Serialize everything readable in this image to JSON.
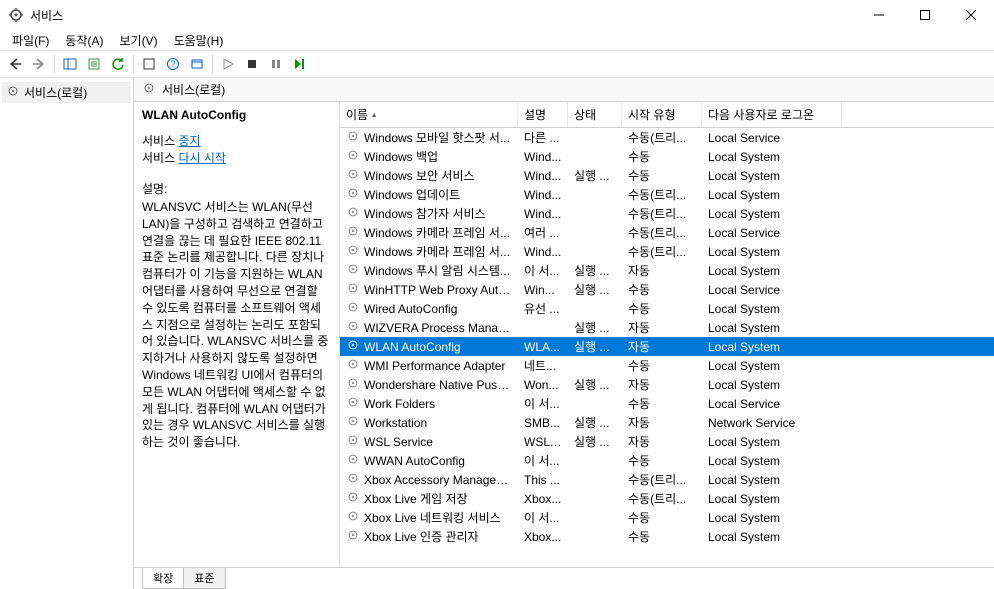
{
  "window": {
    "title": "서비스"
  },
  "menu": {
    "file": "파일(F)",
    "action": "동작(A)",
    "view": "보기(V)",
    "help": "도움말(H)"
  },
  "tree": {
    "root": "서비스(로컬)"
  },
  "right_header": "서비스(로컬)",
  "detail": {
    "title": "WLAN AutoConfig",
    "service_label": "서비스",
    "stop": "중지",
    "restart": "다시 시작",
    "desc_label": "설명:",
    "desc": "WLANSVC 서비스는 WLAN(무선 LAN)을 구성하고 검색하고 연결하고 연결을 끊는 데 필요한 IEEE 802.11 표준 논리를 제공합니다. 다른 장치나 컴퓨터가 이 기능을 지원하는 WLAN 어댑터를 사용하여 무선으로 연결할 수 있도록 컴퓨터를 소프트웨어 액세스 지점으로 설정하는 논리도 포함되어 있습니다. WLANSVC 서비스를 중지하거나 사용하지 않도록 설정하면 Windows 네트워킹 UI에서 컴퓨터의 모든 WLAN 어댑터에 액세스할 수 없게 됩니다. 컴퓨터에 WLAN 어댑터가 있는 경우 WLANSVC 서비스를 실행하는 것이 좋습니다."
  },
  "columns": {
    "name": "이름",
    "desc": "설명",
    "status": "상태",
    "startup": "시작 유형",
    "logon": "다음 사용자로 로그온"
  },
  "services": [
    {
      "name": "Windows 모바일 핫스팟 서...",
      "desc": "다른 ...",
      "status": "",
      "startup": "수동(트리...",
      "logon": "Local Service"
    },
    {
      "name": "Windows 백업",
      "desc": "Wind...",
      "status": "",
      "startup": "수동",
      "logon": "Local System"
    },
    {
      "name": "Windows 보안 서비스",
      "desc": "Wind...",
      "status": "실행 ...",
      "startup": "수동",
      "logon": "Local System"
    },
    {
      "name": "Windows 업데이트",
      "desc": "Wind...",
      "status": "",
      "startup": "수동(트리...",
      "logon": "Local System"
    },
    {
      "name": "Windows 참가자 서비스",
      "desc": "Wind...",
      "status": "",
      "startup": "수동(트리...",
      "logon": "Local System"
    },
    {
      "name": "Windows 카메라 프레임 서...",
      "desc": "여러 ...",
      "status": "",
      "startup": "수동(트리...",
      "logon": "Local Service"
    },
    {
      "name": "Windows 카메라 프레임 서...",
      "desc": "Wind...",
      "status": "",
      "startup": "수동(트리...",
      "logon": "Local System"
    },
    {
      "name": "Windows 푸시 알림 시스템...",
      "desc": "이 서...",
      "status": "실행 ...",
      "startup": "자동",
      "logon": "Local System"
    },
    {
      "name": "WinHTTP Web Proxy Auto-...",
      "desc": "Win...",
      "status": "실행 ...",
      "startup": "수동",
      "logon": "Local Service"
    },
    {
      "name": "Wired AutoConfig",
      "desc": "유선 ...",
      "status": "",
      "startup": "수동",
      "logon": "Local System"
    },
    {
      "name": "WIZVERA Process Manager...",
      "desc": "",
      "status": "실행 ...",
      "startup": "자동",
      "logon": "Local System"
    },
    {
      "name": "WLAN AutoConfig",
      "desc": "WLA...",
      "status": "실행 ...",
      "startup": "자동",
      "logon": "Local System",
      "selected": true
    },
    {
      "name": "WMI Performance Adapter",
      "desc": "네트...",
      "status": "",
      "startup": "수동",
      "logon": "Local System"
    },
    {
      "name": "Wondershare Native Push ...",
      "desc": "Won...",
      "status": "실행 ...",
      "startup": "자동",
      "logon": "Local System"
    },
    {
      "name": "Work Folders",
      "desc": "이 서...",
      "status": "",
      "startup": "수동",
      "logon": "Local Service"
    },
    {
      "name": "Workstation",
      "desc": "SMB...",
      "status": "실행 ...",
      "startup": "자동",
      "logon": "Network Service"
    },
    {
      "name": "WSL Service",
      "desc": "WSL ...",
      "status": "실행 ...",
      "startup": "자동",
      "logon": "Local System"
    },
    {
      "name": "WWAN AutoConfig",
      "desc": "이 서...",
      "status": "",
      "startup": "수동",
      "logon": "Local System"
    },
    {
      "name": "Xbox Accessory Managem...",
      "desc": "This ...",
      "status": "",
      "startup": "수동(트리...",
      "logon": "Local System"
    },
    {
      "name": "Xbox Live 게임 저장",
      "desc": "Xbox...",
      "status": "",
      "startup": "수동(트리...",
      "logon": "Local System"
    },
    {
      "name": "Xbox Live 네트워킹 서비스",
      "desc": "이 서...",
      "status": "",
      "startup": "수동",
      "logon": "Local System"
    },
    {
      "name": "Xbox Live 인증 관리자",
      "desc": "Xbox...",
      "status": "",
      "startup": "수동",
      "logon": "Local System"
    }
  ],
  "tabs": {
    "extended": "확장",
    "standard": "표준"
  }
}
